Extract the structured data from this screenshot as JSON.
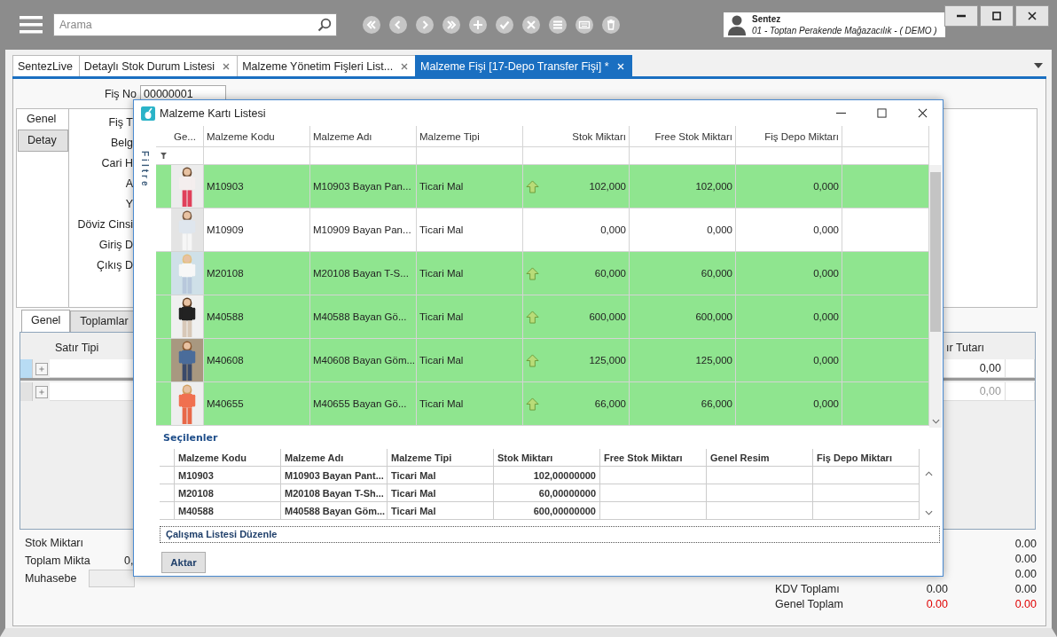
{
  "top_bar": {
    "search": {
      "placeholder": "Arama"
    },
    "user": {
      "name": "Sentez",
      "company": "01 - Toptan Perakende Mağazacılık - ( DEMO )"
    }
  },
  "tabs": [
    {
      "label": "SentezLive",
      "closable": false,
      "selected": false
    },
    {
      "label": "Detaylı Stok Durum Listesi",
      "closable": true,
      "selected": false
    },
    {
      "label": "Malzeme Yönetim Fişleri List...",
      "closable": true,
      "selected": false
    },
    {
      "label": "Malzeme Fişi  [17-Depo Transfer Fişi] *",
      "closable": true,
      "selected": true
    }
  ],
  "form": {
    "fis_no": {
      "label": "Fiş No",
      "value": "00000001"
    },
    "side_tabs": [
      {
        "label": "Genel",
        "selected": true
      },
      {
        "label": "Detay",
        "selected": false
      }
    ],
    "field_labels": [
      "Fiş T",
      "Belg",
      "Cari H",
      "A",
      "Y",
      "Döviz Cinsi",
      "Giriş D",
      "Çıkış D"
    ]
  },
  "lines": {
    "tabs": [
      {
        "label": "Genel",
        "selected": true
      },
      {
        "label": "Toplamlar",
        "selected": false
      }
    ],
    "columns": [
      "Satır Tipi",
      "ır Tutarı"
    ],
    "rows": [
      {
        "value": "0,00",
        "selected": true,
        "dimmed": false
      },
      {
        "value": "0,00",
        "selected": false,
        "dimmed": true
      }
    ]
  },
  "summary": {
    "left": [
      {
        "label": "Stok Miktarı"
      },
      {
        "label": "Toplam Mikta",
        "value": "0,"
      },
      {
        "label": "Muhasebe",
        "kind": "field"
      }
    ],
    "totals": [
      {
        "value_2": "0.00",
        "emphasis": false
      },
      {
        "value_2": "0.00",
        "emphasis": false
      },
      {
        "value_2": "0.00",
        "emphasis": false
      },
      {
        "label": "KDV Toplamı",
        "value_1": "0.00",
        "value_2": "0.00",
        "emphasis": false
      },
      {
        "label": "Genel Toplam",
        "value_1": "0.00",
        "value_2": "0.00",
        "emphasis": true
      }
    ]
  },
  "dialog": {
    "title": "Malzeme Kartı Listesi",
    "filter_label": "Filtre",
    "columns": [
      "Ge...",
      "Malzeme Kodu",
      "Malzeme Adı",
      "Malzeme Tipi",
      "Stok Miktarı",
      "Free Stok Miktarı",
      "Fiş Depo Miktarı"
    ],
    "rows": [
      {
        "code": "M10903",
        "name": "M10903 Bayan Pan...",
        "type": "Ticari Mal",
        "stock": "102,000",
        "free_stock": "102,000",
        "depot": "0,000",
        "highlighted": true
      },
      {
        "code": "M10909",
        "name": "M10909 Bayan Pan...",
        "type": "Ticari Mal",
        "stock": "0,000",
        "free_stock": "0,000",
        "depot": "0,000",
        "highlighted": false
      },
      {
        "code": "M20108",
        "name": "M20108 Bayan T-S...",
        "type": "Ticari Mal",
        "stock": "60,000",
        "free_stock": "60,000",
        "depot": "0,000",
        "highlighted": true
      },
      {
        "code": "M40588",
        "name": "M40588 Bayan Gö...",
        "type": "Ticari Mal",
        "stock": "600,000",
        "free_stock": "600,000",
        "depot": "0,000",
        "highlighted": true
      },
      {
        "code": "M40608",
        "name": "M40608 Bayan Göm...",
        "type": "Ticari Mal",
        "stock": "125,000",
        "free_stock": "125,000",
        "depot": "0,000",
        "highlighted": true
      },
      {
        "code": "M40655",
        "name": "M40655 Bayan Gö...",
        "type": "Ticari Mal",
        "stock": "66,000",
        "free_stock": "66,000",
        "depot": "0,000",
        "highlighted": true
      }
    ],
    "selected_title": "Seçilenler",
    "selected_columns": [
      "Malzeme Kodu",
      "Malzeme Adı",
      "Malzeme Tipi",
      "Stok Miktarı",
      "Free Stok Miktarı",
      "Genel Resim",
      "Fiş Depo Miktarı"
    ],
    "selected_rows": [
      {
        "code": "M10903",
        "name": "M10903 Bayan Pant...",
        "type": "Ticari Mal",
        "stock": "102,00000000"
      },
      {
        "code": "M20108",
        "name": "M20108 Bayan T-Sh...",
        "type": "Ticari Mal",
        "stock": "60,00000000"
      },
      {
        "code": "M40588",
        "name": "M40588 Bayan Göm...",
        "type": "Ticari Mal",
        "stock": "600,00000000"
      }
    ],
    "worklist_link": "Çalışma Listesi Düzenle",
    "transfer_button": "Aktar"
  }
}
